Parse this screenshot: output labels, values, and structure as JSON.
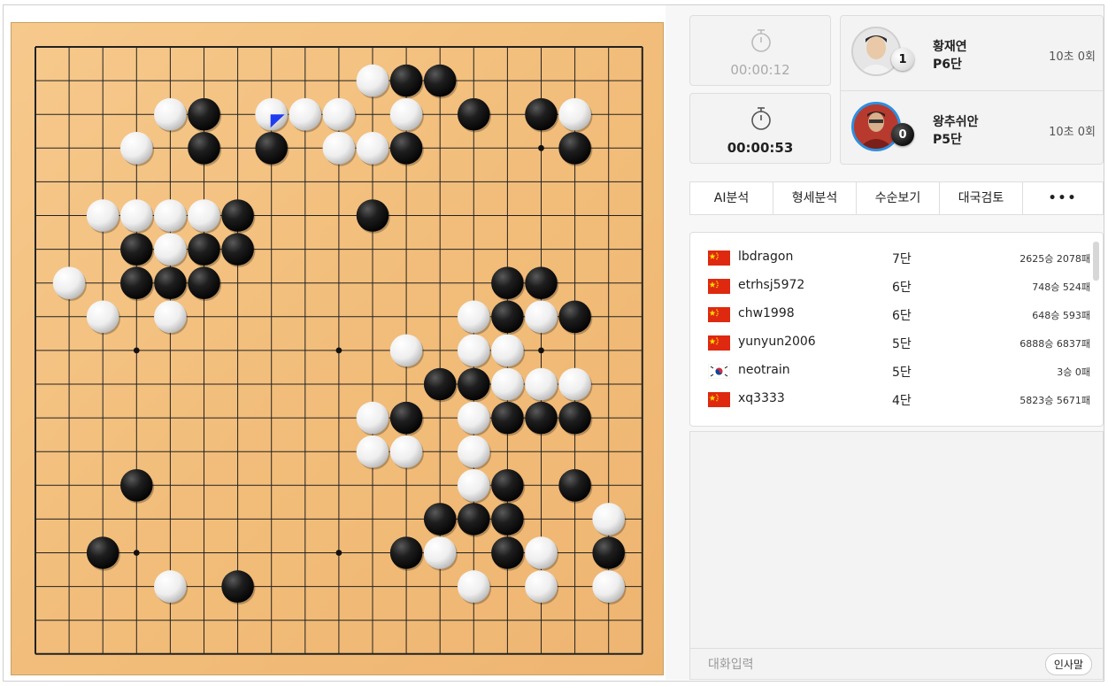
{
  "board": {
    "size": 19,
    "black": [
      [
        11,
        1
      ],
      [
        12,
        1
      ],
      [
        5,
        2
      ],
      [
        13,
        2
      ],
      [
        15,
        2
      ],
      [
        5,
        3
      ],
      [
        7,
        3
      ],
      [
        11,
        3
      ],
      [
        16,
        3
      ],
      [
        6,
        5
      ],
      [
        10,
        5
      ],
      [
        3,
        6
      ],
      [
        5,
        6
      ],
      [
        6,
        6
      ],
      [
        3,
        7
      ],
      [
        4,
        7
      ],
      [
        5,
        7
      ],
      [
        14,
        7
      ],
      [
        15,
        7
      ],
      [
        14,
        8
      ],
      [
        16,
        8
      ],
      [
        12,
        10
      ],
      [
        13,
        10
      ],
      [
        11,
        11
      ],
      [
        14,
        11
      ],
      [
        15,
        11
      ],
      [
        16,
        11
      ],
      [
        3,
        13
      ],
      [
        14,
        13
      ],
      [
        16,
        13
      ],
      [
        12,
        14
      ],
      [
        13,
        14
      ],
      [
        14,
        14
      ],
      [
        2,
        15
      ],
      [
        11,
        15
      ],
      [
        14,
        15
      ],
      [
        17,
        15
      ],
      [
        6,
        16
      ]
    ],
    "white": [
      [
        10,
        1
      ],
      [
        4,
        2
      ],
      [
        7,
        2
      ],
      [
        8,
        2
      ],
      [
        9,
        2
      ],
      [
        11,
        2
      ],
      [
        16,
        2
      ],
      [
        3,
        3
      ],
      [
        9,
        3
      ],
      [
        10,
        3
      ],
      [
        2,
        5
      ],
      [
        3,
        5
      ],
      [
        4,
        5
      ],
      [
        5,
        5
      ],
      [
        4,
        6
      ],
      [
        1,
        7
      ],
      [
        2,
        8
      ],
      [
        4,
        8
      ],
      [
        13,
        8
      ],
      [
        15,
        8
      ],
      [
        11,
        9
      ],
      [
        13,
        9
      ],
      [
        14,
        9
      ],
      [
        14,
        10
      ],
      [
        15,
        10
      ],
      [
        16,
        10
      ],
      [
        10,
        11
      ],
      [
        13,
        11
      ],
      [
        10,
        12
      ],
      [
        11,
        12
      ],
      [
        13,
        12
      ],
      [
        13,
        13
      ],
      [
        17,
        14
      ],
      [
        12,
        15
      ],
      [
        15,
        15
      ],
      [
        4,
        16
      ],
      [
        13,
        16
      ],
      [
        15,
        16
      ],
      [
        17,
        16
      ]
    ],
    "last_move": [
      7,
      2
    ],
    "star_points": [
      [
        3,
        3
      ],
      [
        9,
        3
      ],
      [
        15,
        3
      ],
      [
        3,
        9
      ],
      [
        9,
        9
      ],
      [
        15,
        9
      ],
      [
        3,
        15
      ],
      [
        9,
        15
      ],
      [
        15,
        15
      ]
    ]
  },
  "timers": {
    "top": "00:00:12",
    "bottom": "00:00:53"
  },
  "players": [
    {
      "name": "황재연",
      "rank": "P6단",
      "time": "10초 0회",
      "captures": "1",
      "stone": "white"
    },
    {
      "name": "왕추쉬안",
      "rank": "P5단",
      "time": "10초 0회",
      "captures": "0",
      "stone": "black"
    }
  ],
  "tabs": [
    "AI분석",
    "형세분석",
    "수순보기",
    "대국검토",
    "•••"
  ],
  "observers": [
    {
      "flag": "cn",
      "name": "lbdragon",
      "rank": "7단",
      "record": "2625승 2078패"
    },
    {
      "flag": "cn",
      "name": "etrhsj5972",
      "rank": "6단",
      "record": "748승 524패"
    },
    {
      "flag": "cn",
      "name": "chw1998",
      "rank": "6단",
      "record": "648승 593패"
    },
    {
      "flag": "cn",
      "name": "yunyun2006",
      "rank": "5단",
      "record": "6888승 6837패"
    },
    {
      "flag": "kr",
      "name": "neotrain",
      "rank": "5단",
      "record": "3승 0패"
    },
    {
      "flag": "cn",
      "name": "xq3333",
      "rank": "4단",
      "record": "5823승 5671패"
    }
  ],
  "chat": {
    "placeholder": "대화입력",
    "greet_label": "인사말"
  },
  "colors": {
    "board": "#f3c07d",
    "last_move_marker": "#1f3cf0",
    "active_ring": "#2e8fe0"
  }
}
